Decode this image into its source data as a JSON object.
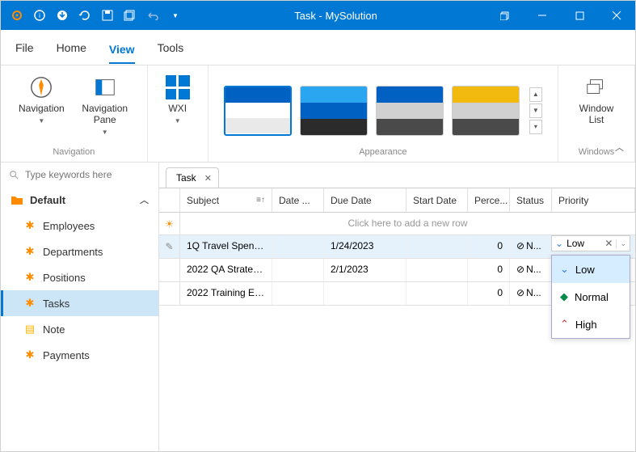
{
  "app": {
    "title": "Task - MySolution"
  },
  "menu": {
    "file": "File",
    "home": "Home",
    "view": "View",
    "tools": "Tools"
  },
  "ribbon": {
    "nav_btn": "Navigation",
    "pane_btn": "Navigation Pane",
    "wxi": "WXI",
    "window_list": "Window List",
    "groups": {
      "navigation": "Navigation",
      "appearance": "Appearance",
      "windows": "Windows"
    }
  },
  "search": {
    "placeholder": "Type keywords here"
  },
  "nav": {
    "root": "Default",
    "items": [
      {
        "label": "Employees"
      },
      {
        "label": "Departments"
      },
      {
        "label": "Positions"
      },
      {
        "label": "Tasks"
      },
      {
        "label": "Note"
      },
      {
        "label": "Payments"
      }
    ]
  },
  "tab": {
    "label": "Task"
  },
  "grid": {
    "cols": {
      "subject": "Subject",
      "date": "Date ...",
      "due": "Due Date",
      "start": "Start Date",
      "perc": "Perce...",
      "status": "Status",
      "priority": "Priority"
    },
    "newrow": "Click here to add a new row",
    "rows": [
      {
        "subject": "1Q Travel Spend R...",
        "date": "",
        "due": "1/24/2023",
        "start": "",
        "perc": "0",
        "status": "N..."
      },
      {
        "subject": "2022 QA Strategy ...",
        "date": "",
        "due": "2/1/2023",
        "start": "",
        "perc": "0",
        "status": "N..."
      },
      {
        "subject": "2022 Training Eve...",
        "date": "",
        "due": "",
        "start": "",
        "perc": "0",
        "status": "N..."
      }
    ]
  },
  "priority": {
    "value": "Low",
    "options": {
      "low": "Low",
      "normal": "Normal",
      "high": "High"
    }
  }
}
